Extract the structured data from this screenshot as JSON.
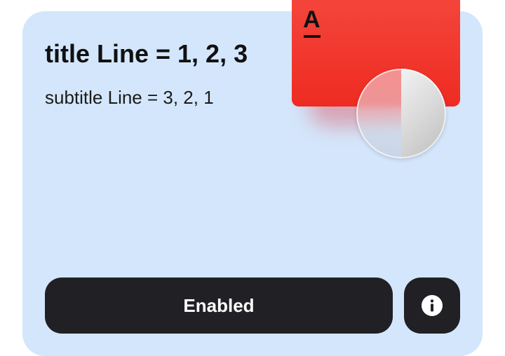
{
  "card": {
    "title": "title Line = 1, 2, 3",
    "subtitle": "subtitle Line = 3, 2, 1",
    "primary_button_label": "Enabled",
    "info_icon": "info-icon",
    "logo_letter": "A",
    "background_color": "#d4e6fb",
    "button_color": "#212024",
    "logo_color": "#ee2b22"
  }
}
